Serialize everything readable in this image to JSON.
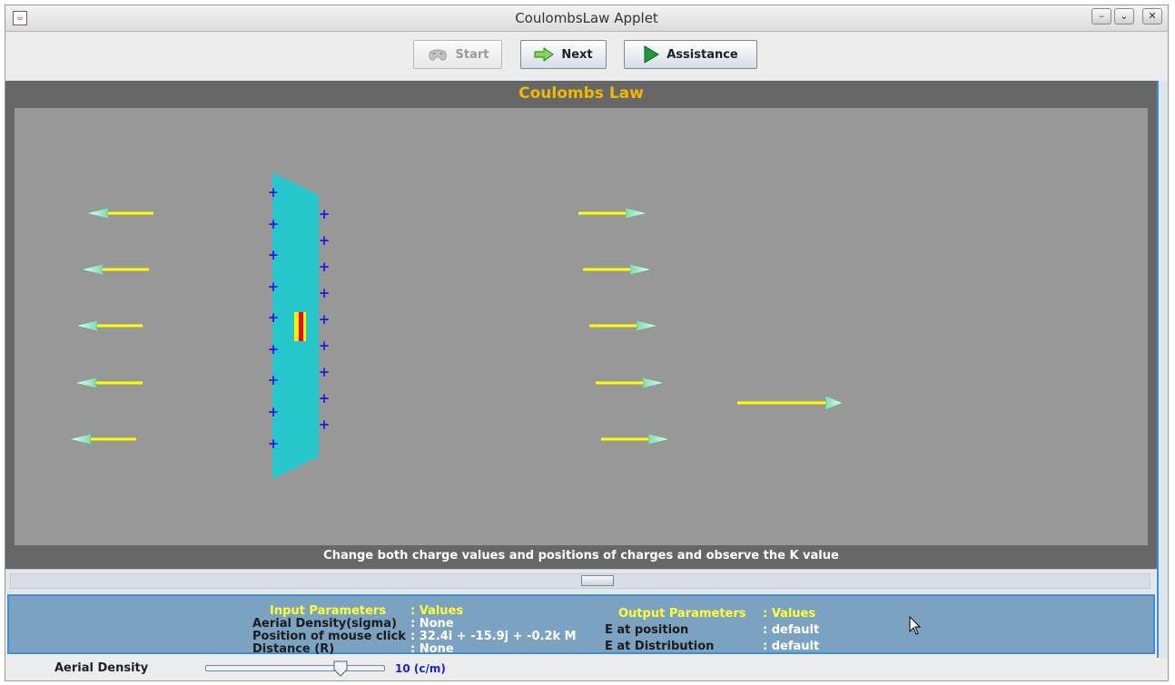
{
  "window": {
    "title": "CoulombsLaw Applet"
  },
  "toolbar": {
    "start_label": "Start",
    "next_label": "Next",
    "assistance_label": "Assistance"
  },
  "simulation": {
    "title": "Coulombs Law",
    "instruction": "Change both charge values and positions of charges and observe the K value",
    "plate_color": "#27c6cc",
    "charge_color": "#1a1adc",
    "arrow_color": "#ffff00",
    "charge_symbol": "+"
  },
  "params": {
    "input_header": "Input Parameters",
    "input_values_header": ":  Values",
    "rows_in": [
      {
        "label": "Aerial Density(sigma)",
        "value": ": None"
      },
      {
        "label": "Position of mouse click",
        "value": ": 32.4i + -15.9j + -0.2k  M"
      },
      {
        "label": "Distance (R)",
        "value": ": None"
      }
    ],
    "output_header": "Output Parameters",
    "output_values_header": ": Values",
    "rows_out": [
      {
        "label": "E at position",
        "value": ": default"
      },
      {
        "label": "E at Distribution",
        "value": ":  default"
      }
    ]
  },
  "bottom": {
    "density_label": "Aerial Density",
    "density_value": "10 (c/m)"
  }
}
